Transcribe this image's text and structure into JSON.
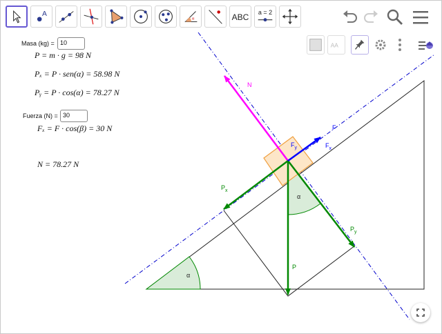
{
  "toolbar": {
    "tools": [
      {
        "name": "move-tool",
        "label": ""
      },
      {
        "name": "point-tool",
        "label": ""
      },
      {
        "name": "line-tool",
        "label": ""
      },
      {
        "name": "perpendicular-tool",
        "label": ""
      },
      {
        "name": "polygon-tool",
        "label": ""
      },
      {
        "name": "circle-tool",
        "label": ""
      },
      {
        "name": "ellipse-tool",
        "label": ""
      },
      {
        "name": "angle-tool",
        "label": ""
      },
      {
        "name": "reflect-tool",
        "label": ""
      },
      {
        "name": "text-tool",
        "label": "ABC"
      },
      {
        "name": "slider-tool",
        "label": "a = 2"
      },
      {
        "name": "move-graphics-view-tool",
        "label": ""
      }
    ],
    "icons": [
      "undo-icon",
      "redo-icon",
      "search-icon",
      "menu-icon"
    ]
  },
  "stylebar": {
    "icons": [
      "background-color-icon",
      "text-style-icon",
      "pin-icon",
      "settings-icon",
      "more-icon",
      "graphics-view-icon"
    ]
  },
  "inputs": {
    "masa": {
      "label": "Masa (kg) =",
      "value": "10"
    },
    "fuerza": {
      "label": "Fuerza (N) =",
      "value": "30"
    }
  },
  "formulas": {
    "peso": "P = m · g = 98  N",
    "px": "Pₓ = P · sen(α) = 58.98  N",
    "py": "Pᵧ = P · cos(α) = 78.27  N",
    "fx": "Fₓ = F · cos(β) = 30  N",
    "normal": "N = 78.27   N"
  },
  "vector_labels": {
    "N": "N",
    "F": "F",
    "Fy": "F",
    "Fy_sub": "y",
    "Fx": "F",
    "Fx_sub": "x",
    "Px": "P",
    "Px_sub": "x",
    "Py": "P",
    "Py_sub": "y",
    "P": "P",
    "alpha_top": "α",
    "alpha_bottom": "α"
  },
  "colors": {
    "accent": "#6557d2",
    "normal": "#ff00ff",
    "force": "#0000ff",
    "weight": "#008800",
    "angle_fill": "#d9ecd9",
    "block_fill": "#fde6c8",
    "block_stroke": "#f0a040",
    "dashdot": "#0000cc"
  }
}
